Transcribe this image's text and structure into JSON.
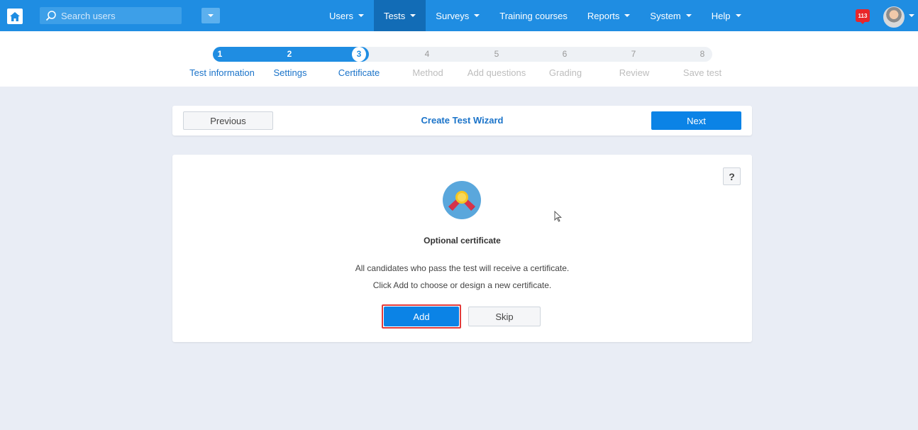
{
  "topbar": {
    "search_placeholder": "Search users",
    "nav": [
      {
        "label": "Users",
        "has_caret": true,
        "active": false
      },
      {
        "label": "Tests",
        "has_caret": true,
        "active": true
      },
      {
        "label": "Surveys",
        "has_caret": true,
        "active": false
      },
      {
        "label": "Training courses",
        "has_caret": false,
        "active": false
      },
      {
        "label": "Reports",
        "has_caret": true,
        "active": false
      },
      {
        "label": "System",
        "has_caret": true,
        "active": false
      },
      {
        "label": "Help",
        "has_caret": true,
        "active": false
      }
    ],
    "notification_count": "113",
    "accent_color": "#1f8de2"
  },
  "steps": [
    {
      "number": "1",
      "label": "Test information",
      "state": "done"
    },
    {
      "number": "2",
      "label": "Settings",
      "state": "done"
    },
    {
      "number": "3",
      "label": "Certificate",
      "state": "current"
    },
    {
      "number": "4",
      "label": "Method",
      "state": "upcoming"
    },
    {
      "number": "5",
      "label": "Add questions",
      "state": "upcoming"
    },
    {
      "number": "6",
      "label": "Grading",
      "state": "upcoming"
    },
    {
      "number": "7",
      "label": "Review",
      "state": "upcoming"
    },
    {
      "number": "8",
      "label": "Save test",
      "state": "upcoming"
    }
  ],
  "wizard": {
    "title": "Create Test Wizard",
    "previous_label": "Previous",
    "next_label": "Next"
  },
  "content": {
    "title": "Optional certificate",
    "line1": "All candidates who pass the test will receive a certificate.",
    "line2": "Click Add to choose or design a new certificate.",
    "add_label": "Add",
    "skip_label": "Skip",
    "help_label": "?",
    "icon": "certificate-ribbon-icon"
  }
}
